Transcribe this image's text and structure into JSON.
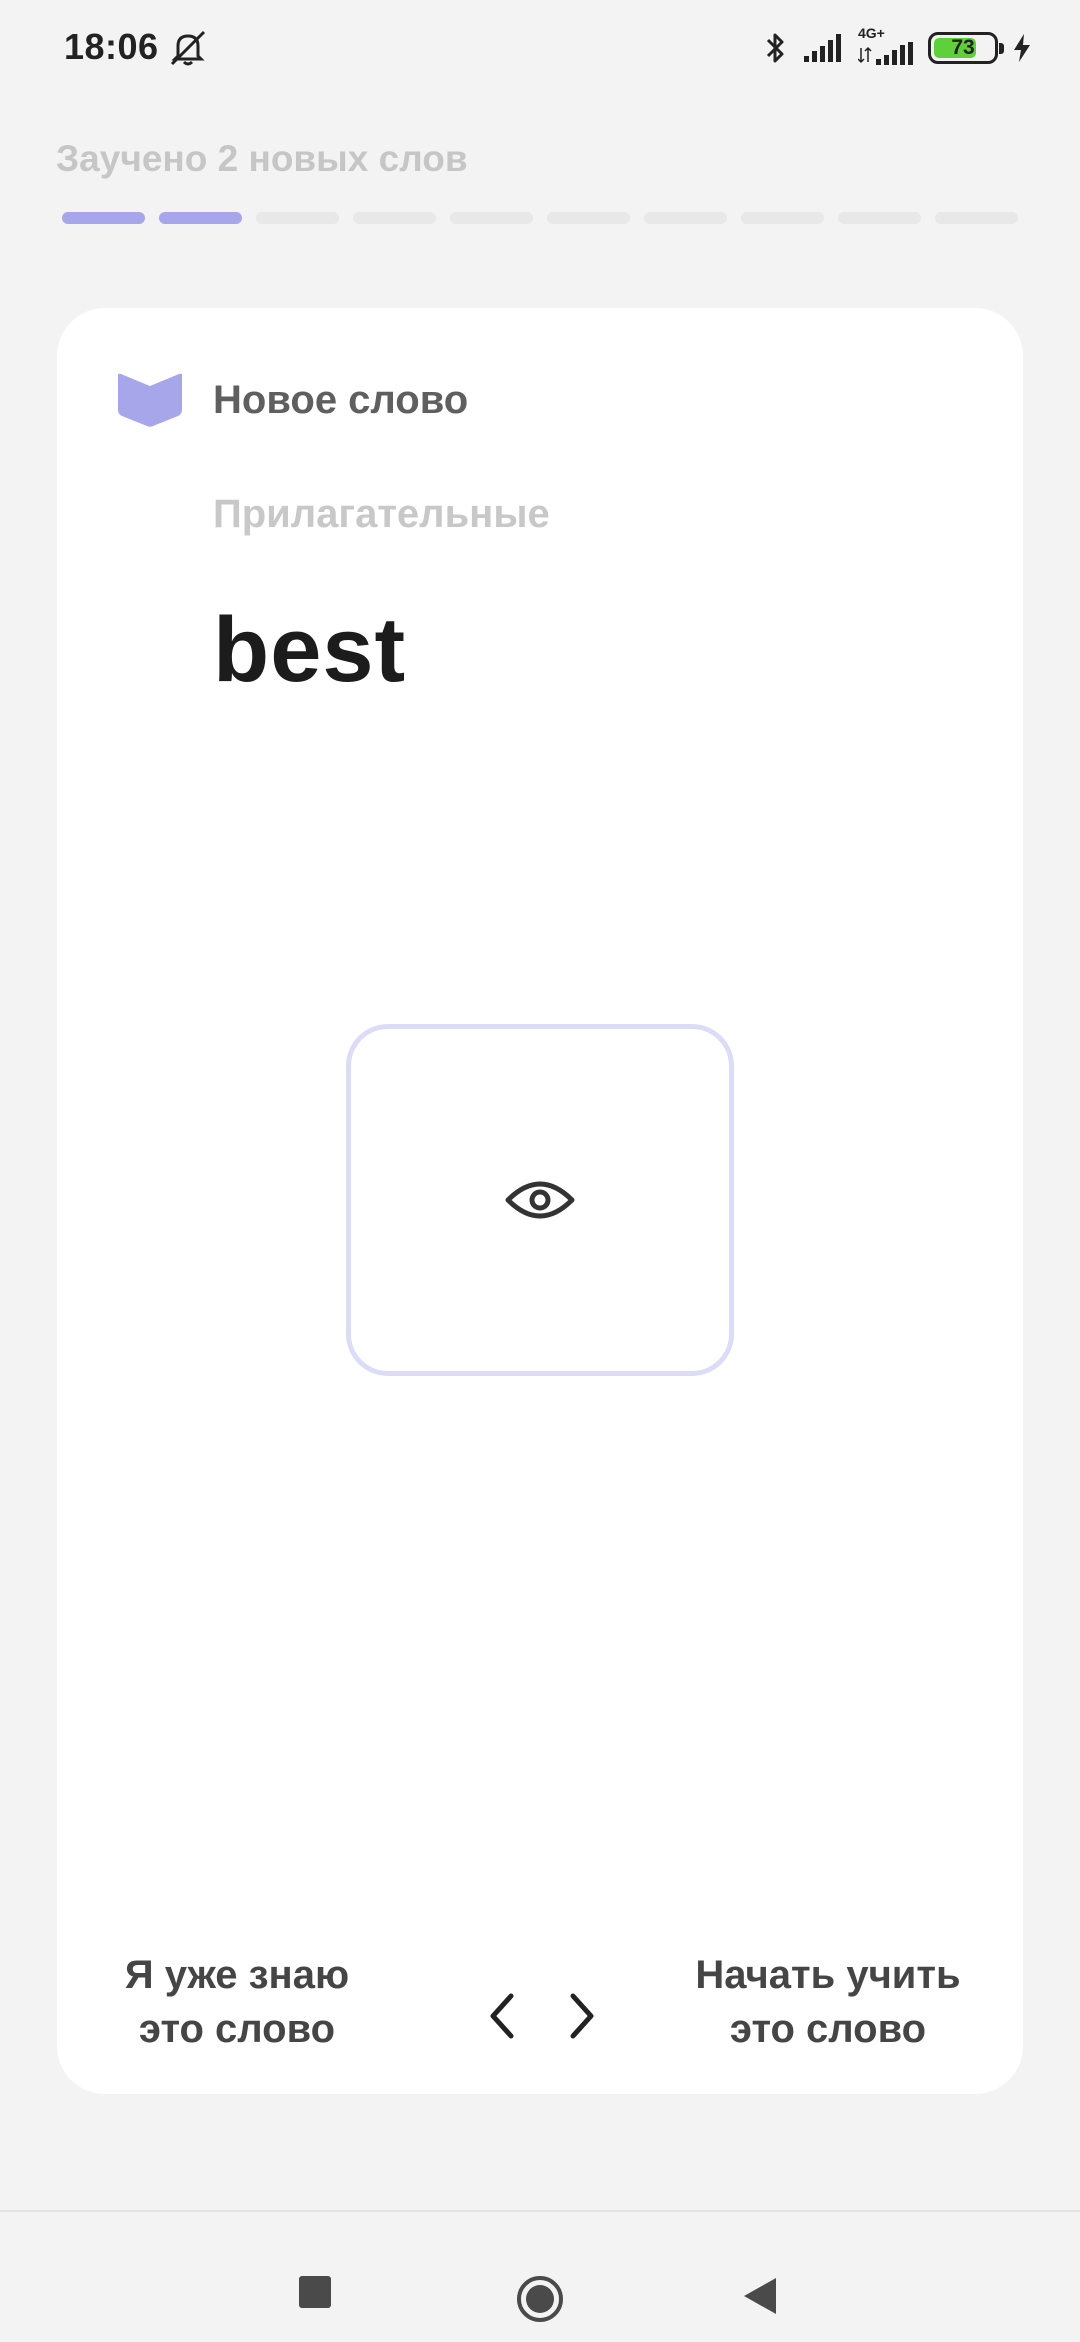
{
  "status_bar": {
    "time": "18:06",
    "network_label": "4G+",
    "battery_level": 73,
    "battery_text": "73",
    "icons": [
      "mute-bell-icon",
      "bluetooth-icon",
      "signal-icon",
      "signal-4g-icon",
      "battery-icon",
      "charging-icon"
    ]
  },
  "progress": {
    "title": "Заучено 2 новых слов",
    "total_segments": 10,
    "completed_segments": 2,
    "accent_color": "#a8a6ea"
  },
  "card": {
    "header_label": "Новое слово",
    "category": "Прилагательные",
    "word": "best",
    "reveal_icon": "eye-icon",
    "reveal_border_color": "#dcdcf6"
  },
  "footer": {
    "know_button": "Я уже знаю это слово",
    "learn_button": "Начать учить это слово",
    "prev_icon": "chevron-left-icon",
    "next_icon": "chevron-right-icon"
  },
  "system_nav": {
    "icons": [
      "recent-apps-icon",
      "home-icon",
      "back-icon"
    ]
  }
}
